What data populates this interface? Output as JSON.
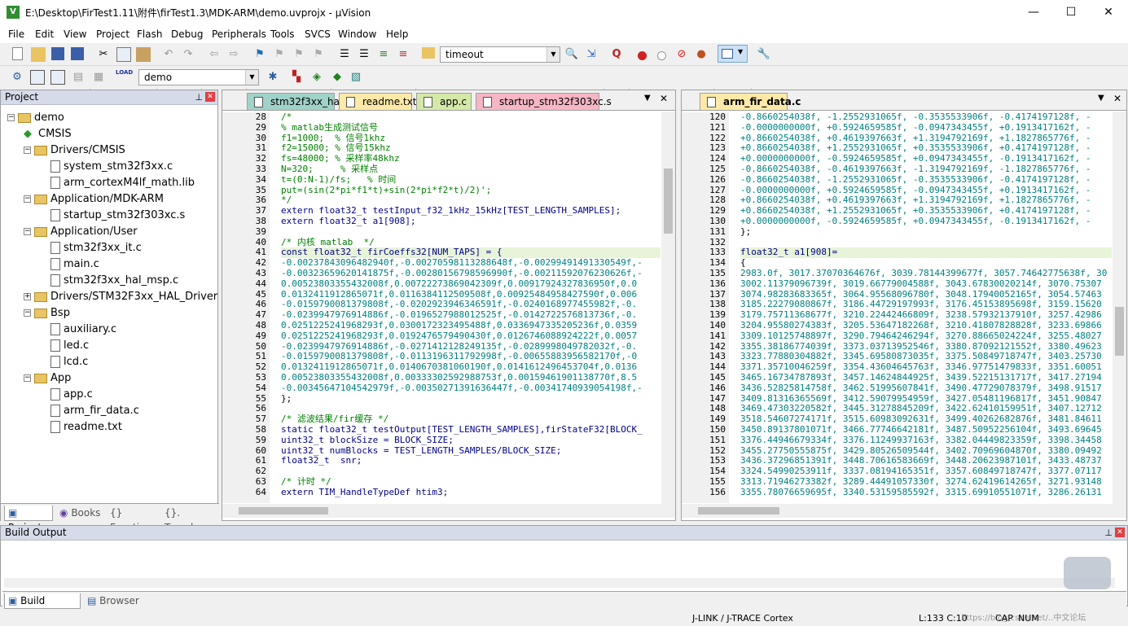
{
  "window": {
    "title": "E:\\Desktop\\FirTest1.11\\附件\\firTest1.3\\MDK-ARM\\demo.uvprojx - µVision",
    "minimize": "—",
    "maximize": "☐",
    "close": "✕"
  },
  "menu": [
    "File",
    "Edit",
    "View",
    "Project",
    "Flash",
    "Debug",
    "Peripherals",
    "Tools",
    "SVCS",
    "Window",
    "Help"
  ],
  "toolbar": {
    "find_value": "timeout",
    "target_value": "demo"
  },
  "project": {
    "title": "Project",
    "tree": [
      {
        "label": "demo",
        "level": 0,
        "type": "root"
      },
      {
        "label": "CMSIS",
        "level": 1,
        "type": "diamond"
      },
      {
        "label": "Drivers/CMSIS",
        "level": 1,
        "type": "folder"
      },
      {
        "label": "system_stm32f3xx.c",
        "level": 2,
        "type": "file"
      },
      {
        "label": "arm_cortexM4lf_math.lib",
        "level": 2,
        "type": "file"
      },
      {
        "label": "Application/MDK-ARM",
        "level": 1,
        "type": "folder"
      },
      {
        "label": "startup_stm32f303xc.s",
        "level": 2,
        "type": "file"
      },
      {
        "label": "Application/User",
        "level": 1,
        "type": "folder"
      },
      {
        "label": "stm32f3xx_it.c",
        "level": 2,
        "type": "file"
      },
      {
        "label": "main.c",
        "level": 2,
        "type": "file"
      },
      {
        "label": "stm32f3xx_hal_msp.c",
        "level": 2,
        "type": "file"
      },
      {
        "label": "Drivers/STM32F3xx_HAL_Driver",
        "level": 1,
        "type": "folder"
      },
      {
        "label": "Bsp",
        "level": 1,
        "type": "folder"
      },
      {
        "label": "auxiliary.c",
        "level": 2,
        "type": "file"
      },
      {
        "label": "led.c",
        "level": 2,
        "type": "file"
      },
      {
        "label": "lcd.c",
        "level": 2,
        "type": "file"
      },
      {
        "label": "App",
        "level": 1,
        "type": "folder"
      },
      {
        "label": "app.c",
        "level": 2,
        "type": "file"
      },
      {
        "label": "arm_fir_data.c",
        "level": 2,
        "type": "file"
      },
      {
        "label": "readme.txt",
        "level": 2,
        "type": "file"
      }
    ],
    "tabs": [
      "Project",
      "Books",
      "{} Functi...",
      "{}. Templa..."
    ]
  },
  "editor_left": {
    "tabs": [
      {
        "label": "stm32f3xx_hal.c",
        "color": "#9fd2c8"
      },
      {
        "label": "readme.txt",
        "color": "#ffe9a8"
      },
      {
        "label": "app.c",
        "color": "#d4e8a8"
      },
      {
        "label": "startup_stm32f303xc.s",
        "color": "#f6b6c4"
      }
    ],
    "lines": [
      {
        "n": "28",
        "t": "/*",
        "c": "cm"
      },
      {
        "n": "29",
        "t": "% matlab生成测试信号",
        "c": "cm"
      },
      {
        "n": "30",
        "t": "f1=1000;  % 信号1khz",
        "c": "cm"
      },
      {
        "n": "31",
        "t": "f2=15000; % 信号15khz",
        "c": "cm"
      },
      {
        "n": "32",
        "t": "fs=48000; % 采样率48khz",
        "c": "cm"
      },
      {
        "n": "33",
        "t": "N=320;     % 采样点",
        "c": "cm"
      },
      {
        "n": "34",
        "t": "t=(0:N-1)/fs;   % 时间",
        "c": "cm"
      },
      {
        "n": "35",
        "t": "put=(sin(2*pi*f1*t)+sin(2*pi*f2*t)/2)';",
        "c": "cm"
      },
      {
        "n": "36",
        "t": "*/",
        "c": "cm"
      },
      {
        "n": "37",
        "t": "extern float32_t testInput_f32_1kHz_15kHz[TEST_LENGTH_SAMPLES];",
        "c": "kw"
      },
      {
        "n": "38",
        "t": "extern float32_t a1[908];",
        "c": "kw"
      },
      {
        "n": "39",
        "t": "",
        "c": "tx"
      },
      {
        "n": "40",
        "t": "/* 内核 matlab  */",
        "c": "cm"
      },
      {
        "n": "41",
        "t": "const float32_t firCoeffs32[NUM_TAPS] = {",
        "c": "kw"
      },
      {
        "n": "42",
        "t": "-0.00237843096482940f,-0.00270598113288648f,-0.00299491491330549f,-",
        "c": "num"
      },
      {
        "n": "43",
        "t": "-0.00323659620141875f,-0.00280156798596990f,-0.00211592076230626f,-",
        "c": "num"
      },
      {
        "n": "44",
        "t": "0.00523803355432008f,0.00722273869042309f,0.00917924327836950f,0.0",
        "c": "num"
      },
      {
        "n": "45",
        "t": "0.0132411912865071f,0.0116384112509508f,0.00925484958427590f,0.006",
        "c": "num"
      },
      {
        "n": "46",
        "t": "-0.0159790081379808f,-0.0202923946346591f,-0.0240168977455982f,-0.",
        "c": "num"
      },
      {
        "n": "47",
        "t": "-0.0239947976914886f,-0.0196527988012525f,-0.0142722576813736f,-0.",
        "c": "num"
      },
      {
        "n": "48",
        "t": "0.0251225241968293f,0.0300172323495488f,0.0336947335205236f,0.0359",
        "c": "num"
      },
      {
        "n": "49",
        "t": "0.0251225241968293f,0.0192476579490430f,0.0126746088924222f,0.0057",
        "c": "num"
      },
      {
        "n": "50",
        "t": "-0.0239947976914886f,-0.0271412128249135f,-0.0289998049782032f,-0.",
        "c": "num"
      },
      {
        "n": "51",
        "t": "-0.0159790081379808f,-0.0113196311792998f,-0.00655883956582170f,-0",
        "c": "num"
      },
      {
        "n": "52",
        "t": "0.0132411912865071f,0.0140670381060190f,0.0141612496453704f,0.0136",
        "c": "num"
      },
      {
        "n": "53",
        "t": "0.00523803355432008f,0.00333302592988753f,0.00159461901138770f,8.5",
        "c": "num"
      },
      {
        "n": "54",
        "t": "-0.00345647104542979f,-0.00350271391636447f,-0.00341740939054198f,-",
        "c": "num"
      },
      {
        "n": "55",
        "t": "};",
        "c": "tx"
      },
      {
        "n": "56",
        "t": "",
        "c": "tx"
      },
      {
        "n": "57",
        "t": "/* 滤波结果/fir缓存 */",
        "c": "cm"
      },
      {
        "n": "58",
        "t": "static float32_t testOutput[TEST_LENGTH_SAMPLES],firStateF32[BLOCK_",
        "c": "kw"
      },
      {
        "n": "59",
        "t": "uint32_t blockSize = BLOCK_SIZE;",
        "c": "kw"
      },
      {
        "n": "60",
        "t": "uint32_t numBlocks = TEST_LENGTH_SAMPLES/BLOCK_SIZE;",
        "c": "kw"
      },
      {
        "n": "61",
        "t": "float32_t  snr;",
        "c": "kw"
      },
      {
        "n": "62",
        "t": "",
        "c": "tx"
      },
      {
        "n": "63",
        "t": "/* 计时 */",
        "c": "cm"
      },
      {
        "n": "64",
        "t": "extern TIM_HandleTypeDef htim3;",
        "c": "kw"
      }
    ]
  },
  "editor_right": {
    "tab": {
      "label": "arm_fir_data.c",
      "color": "#ffe9a8"
    },
    "lines": [
      {
        "n": "120",
        "t": "-0.8660254038f, -1.2552931065f, -0.3535533906f, -0.4174197128f, -",
        "c": "num"
      },
      {
        "n": "121",
        "t": "-0.0000000000f, +0.5924659585f, -0.0947343455f, +0.1913417162f, -",
        "c": "num"
      },
      {
        "n": "122",
        "t": "+0.8660254038f, +0.4619397663f, +1.3194792169f, +1.1827865776f, -",
        "c": "num"
      },
      {
        "n": "123",
        "t": "+0.8660254038f, +1.2552931065f, +0.3535533906f, +0.4174197128f, -",
        "c": "num"
      },
      {
        "n": "124",
        "t": "+0.0000000000f, -0.5924659585f, +0.0947343455f, -0.1913417162f, -",
        "c": "num"
      },
      {
        "n": "125",
        "t": "-0.8660254038f, -0.4619397663f, -1.3194792169f, -1.1827865776f, -",
        "c": "num"
      },
      {
        "n": "126",
        "t": "-0.8660254038f, -1.2552931065f, -0.3535533906f, -0.4174197128f, -",
        "c": "num"
      },
      {
        "n": "127",
        "t": "-0.0000000000f, +0.5924659585f, -0.0947343455f, +0.1913417162f, -",
        "c": "num"
      },
      {
        "n": "128",
        "t": "+0.8660254038f, +0.4619397663f, +1.3194792169f, +1.1827865776f, -",
        "c": "num"
      },
      {
        "n": "129",
        "t": "+0.8660254038f, +1.2552931065f, +0.3535533906f, +0.4174197128f, -",
        "c": "num"
      },
      {
        "n": "130",
        "t": "+0.0000000000f, -0.5924659585f, +0.0947343455f, -0.1913417162f, -",
        "c": "num"
      },
      {
        "n": "131",
        "t": "};",
        "c": "tx"
      },
      {
        "n": "132",
        "t": "",
        "c": "tx"
      },
      {
        "n": "133",
        "t": "float32_t a1[908]=",
        "c": "kw"
      },
      {
        "n": "134",
        "t": "{",
        "c": "tx"
      },
      {
        "n": "135",
        "t": "2983.0f, 3017.37070364676f, 3039.78144399677f, 3057.74642775638f, 30",
        "c": "num"
      },
      {
        "n": "136",
        "t": "3002.11379096739f, 3019.66779004588f, 3043.67830020214f, 3070.75307",
        "c": "num"
      },
      {
        "n": "137",
        "t": "3074.98283683365f, 3064.95568096780f, 3048.17940052165f, 3054.57463",
        "c": "num"
      },
      {
        "n": "138",
        "t": "3185.22279080867f, 3186.44729197993f, 3176.45153895698f, 3159.15620",
        "c": "num"
      },
      {
        "n": "139",
        "t": "3179.75711368677f, 3210.22442466809f, 3238.57932137910f, 3257.42986",
        "c": "num"
      },
      {
        "n": "140",
        "t": "3204.95580274383f, 3205.53647182268f, 3210.41807828828f, 3233.69866",
        "c": "num"
      },
      {
        "n": "141",
        "t": "3309.10125748897f, 3290.79464246294f, 3270.88665024224f, 3255.48027",
        "c": "num"
      },
      {
        "n": "142",
        "t": "3355.38186774039f, 3373.03713952546f, 3380.87092121552f, 3380.49623",
        "c": "num"
      },
      {
        "n": "143",
        "t": "3323.77880304882f, 3345.69580873035f, 3375.50849718747f, 3403.25730",
        "c": "num"
      },
      {
        "n": "144",
        "t": "3371.35710046259f, 3354.43604645763f, 3346.97751479833f, 3351.60051",
        "c": "num"
      },
      {
        "n": "145",
        "t": "3465.16734787893f, 3457.14624844925f, 3439.52215131717f, 3417.27194",
        "c": "num"
      },
      {
        "n": "146",
        "t": "3436.52825814758f, 3462.51995607841f, 3490.47729078379f, 3498.91517",
        "c": "num"
      },
      {
        "n": "147",
        "t": "3409.81316365569f, 3412.59079954959f, 3427.05481196817f, 3451.90847",
        "c": "num"
      },
      {
        "n": "148",
        "t": "3469.47303220582f, 3445.31278845209f, 3422.62410159951f, 3407.12712",
        "c": "num"
      },
      {
        "n": "149",
        "t": "3518.54607274171f, 3515.60983092631f, 3499.40262682876f, 3481.84611",
        "c": "num"
      },
      {
        "n": "150",
        "t": "3450.89137801071f, 3466.77746642181f, 3487.50952256104f, 3493.69645",
        "c": "num"
      },
      {
        "n": "151",
        "t": "3376.44946679334f, 3376.11249937163f, 3382.04449823359f, 3398.34458",
        "c": "num"
      },
      {
        "n": "152",
        "t": "3455.27750555875f, 3429.80526509544f, 3402.70969604870f, 3380.09492",
        "c": "num"
      },
      {
        "n": "153",
        "t": "3436.37296851391f, 3448.70616583669f, 3448.20623987101f, 3433.48737",
        "c": "num"
      },
      {
        "n": "154",
        "t": "3324.54990253911f, 3337.08194165351f, 3357.60849718747f, 3377.07117",
        "c": "num"
      },
      {
        "n": "155",
        "t": "3313.71946273382f, 3289.44491057330f, 3274.62419614265f, 3271.93148",
        "c": "num"
      },
      {
        "n": "156",
        "t": "3355.78076659695f, 3340.53159585592f, 3315.69910551071f, 3286.26131",
        "c": "num"
      }
    ]
  },
  "build": {
    "title": "Build Output",
    "tabs": [
      "Build Output",
      "Browser"
    ]
  },
  "status": {
    "debugger": "J-LINK / J-TRACE Cortex",
    "position": "L:133 C:10",
    "caps": "CAP",
    "num": "NUM",
    "watermark": "https://blog.csdn.net/..中文论坛"
  }
}
